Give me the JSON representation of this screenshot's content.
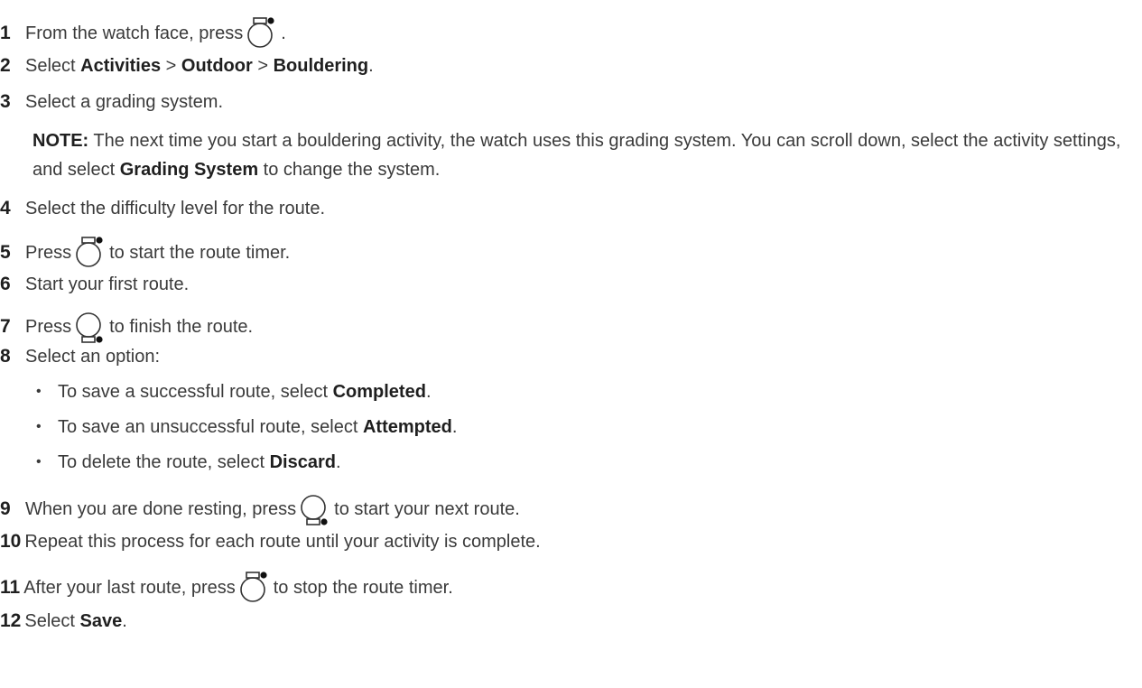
{
  "steps": [
    {
      "num": "1",
      "parts": [
        "From the watch face, press",
        "."
      ]
    },
    {
      "num": "2",
      "a": "Select ",
      "b1": "Activities",
      "c": " > ",
      "b2": "Outdoor",
      "d": " > ",
      "b3": "Bouldering",
      "e": "."
    },
    {
      "num": "3",
      "text": "Select a grading system."
    },
    {
      "note_label": "NOTE:",
      "note_text": " The next time you start a bouldering activity, the watch uses this grading system. You can scroll down, select the activity settings, and select ",
      "note_bold": "Grading System",
      "note_end": " to change the system."
    },
    {
      "num": "4",
      "text": "Select the difficulty level for the route."
    },
    {
      "num": "5",
      "pre": "Press",
      "post": "to start the route timer."
    },
    {
      "num": "6",
      "text": "Start your first route."
    },
    {
      "num": "7",
      "pre": "Press",
      "post": "to finish the route."
    },
    {
      "num": "8",
      "text": "Select an option:"
    },
    {
      "num": "9",
      "pre": "When you are done resting, press",
      "post": "to start your next route."
    },
    {
      "num": "10",
      "text": "Repeat this process for each route until your activity is complete."
    },
    {
      "num": "11",
      "pre": "After your last route, press",
      "post": "to stop the route timer."
    },
    {
      "num": "12",
      "a": "Select ",
      "b": "Save",
      "e": "."
    }
  ],
  "options": [
    {
      "bullet": "•",
      "a": "To save a successful route, select ",
      "b": "Completed",
      "e": "."
    },
    {
      "bullet": "•",
      "a": "To save an unsuccessful route, select ",
      "b": "Attempted",
      "e": "."
    },
    {
      "bullet": "•",
      "a": "To delete the route, select ",
      "b": "Discard",
      "e": "."
    }
  ],
  "icons": {
    "start": "watch-start-stop-button-icon",
    "lap": "watch-lap-button-icon"
  }
}
